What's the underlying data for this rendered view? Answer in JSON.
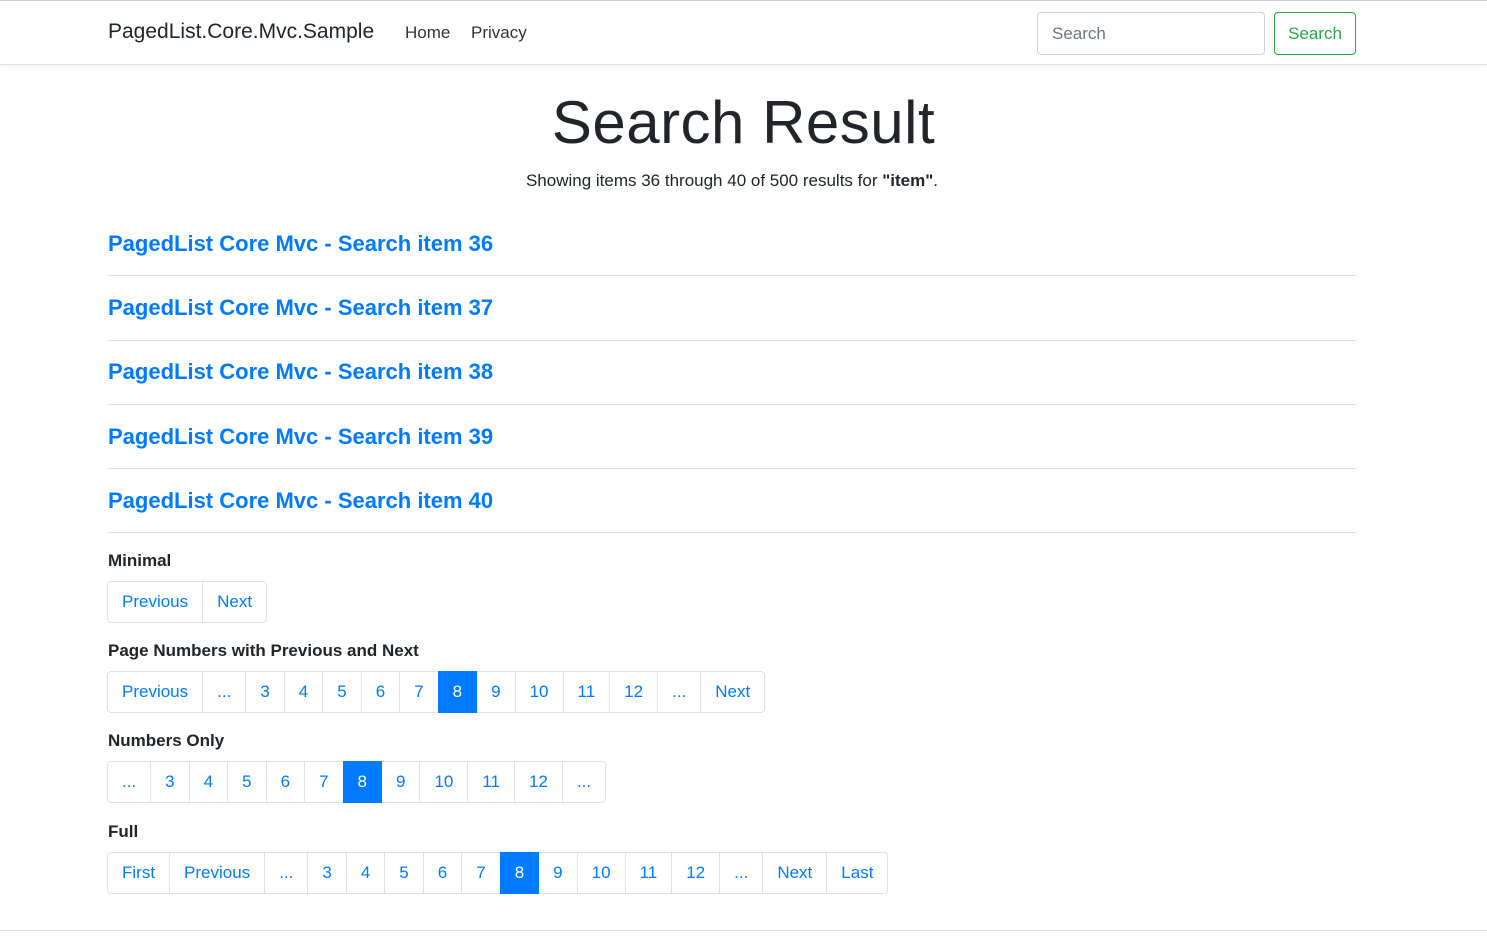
{
  "navbar": {
    "brand": "PagedList.Core.Mvc.Sample",
    "links": [
      "Home",
      "Privacy"
    ],
    "search_placeholder": "Search",
    "search_button": "Search"
  },
  "title": "Search Result",
  "summary": {
    "prefix": "Showing items 36 through 40 of 500 results for ",
    "query": "\"item\"",
    "suffix": "."
  },
  "results": [
    "PagedList Core Mvc - Search item 36",
    "PagedList Core Mvc - Search item 37",
    "PagedList Core Mvc - Search item 38",
    "PagedList Core Mvc - Search item 39",
    "PagedList Core Mvc - Search item 40"
  ],
  "pagers": [
    {
      "label": "Minimal",
      "items": [
        "Previous",
        "Next"
      ],
      "active": ""
    },
    {
      "label": "Page Numbers with Previous and Next",
      "items": [
        "Previous",
        "...",
        "3",
        "4",
        "5",
        "6",
        "7",
        "8",
        "9",
        "10",
        "11",
        "12",
        "...",
        "Next"
      ],
      "active": "8"
    },
    {
      "label": "Numbers Only",
      "items": [
        "...",
        "3",
        "4",
        "5",
        "6",
        "7",
        "8",
        "9",
        "10",
        "11",
        "12",
        "..."
      ],
      "active": "8"
    },
    {
      "label": "Full",
      "items": [
        "First",
        "Previous",
        "...",
        "3",
        "4",
        "5",
        "6",
        "7",
        "8",
        "9",
        "10",
        "11",
        "12",
        "...",
        "Next",
        "Last"
      ],
      "active": "8"
    }
  ],
  "colors": {
    "primary": "#007bff",
    "success": "#28a745",
    "text": "#212529",
    "border": "#dee2e6"
  }
}
